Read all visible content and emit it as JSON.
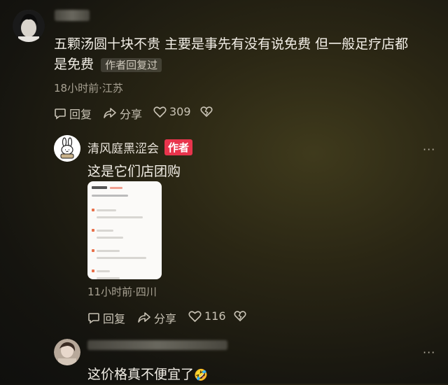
{
  "comment1": {
    "text": "五颗汤圆十块不贵 主要是事先有没有说免费 但一般足疗店都是免费",
    "line1": "五颗汤圆十块不贵 主要是事先有没有说免费 但一般足疗店都",
    "line2": "是免费",
    "badge": "作者回复过",
    "meta": "18小时前·江苏",
    "reply_label": "回复",
    "share_label": "分享",
    "likes": "309"
  },
  "reply1": {
    "name": "清风庭黑涩会",
    "badge": "作者",
    "text": "这是它们店团购",
    "meta": "11小时前·四川",
    "reply_label": "回复",
    "share_label": "分享",
    "likes": "116",
    "more": "···"
  },
  "reply2": {
    "text": "这价格真不便宜了",
    "emoji": "🤣",
    "more": "···"
  },
  "icons": [
    "reply-icon",
    "share-icon",
    "heart-icon",
    "dislike-icon",
    "more-icon"
  ],
  "colors": {
    "author_badge": "#e8344c",
    "background": "#2a2614"
  }
}
